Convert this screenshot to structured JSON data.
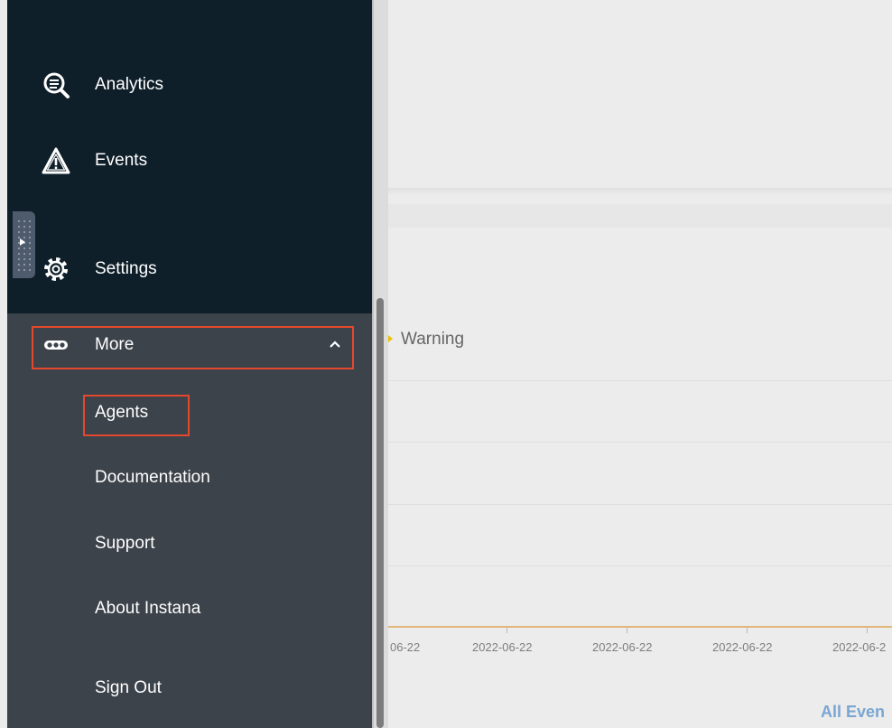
{
  "sidebar": {
    "items": [
      {
        "label": "Analytics",
        "icon": "analytics-icon"
      },
      {
        "label": "Events",
        "icon": "warning-triangle-icon"
      },
      {
        "label": "Settings",
        "icon": "gear-icon"
      }
    ],
    "more": {
      "label": "More",
      "icon": "more-dots-icon",
      "expanded": true
    },
    "sub_items": [
      "Agents",
      "Documentation",
      "Support",
      "About Instana",
      "Sign Out"
    ]
  },
  "chart": {
    "legend": "Warning",
    "x_ticks": [
      "06-22",
      "2022-06-22",
      "2022-06-22",
      "2022-06-22",
      "2022-06-2"
    ]
  },
  "footer": {
    "all_events": "All Even"
  },
  "colors": {
    "sidebar_dark": "#0f1f2a",
    "sidebar_gray": "#3d434b",
    "highlight": "#e4482d",
    "warning": "#f0c000",
    "link": "#7aa6d2"
  }
}
